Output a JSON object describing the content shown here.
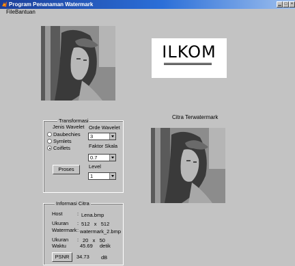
{
  "window": {
    "title": "Program Penanaman Watermark"
  },
  "menu": {
    "items": [
      "File",
      "Bantuan"
    ]
  },
  "logo": {
    "text": "ILKOM"
  },
  "watermarked": {
    "title": "Citra Terwatermark"
  },
  "transform": {
    "title": "Transformasi",
    "wavelet_type_label": "Jenis Wavelet",
    "options": [
      "Daubechies",
      "Symlets",
      "Coiflets"
    ],
    "selected_index": 2,
    "order_label": "Orde Wavelet",
    "order_value": "3",
    "scale_label": "Faktor Skala",
    "scale_value": "0.7",
    "level_label": "Level",
    "level_value": "1",
    "process_button": "Proses"
  },
  "info": {
    "title": "Informasi Citra",
    "host_label": "Host",
    "host_colon": ":",
    "host_value": "Lena.bmp",
    "size1_label": "Ukuran",
    "size1_colon": ":",
    "size1_value": "512   x   512",
    "watermark_label": "Watermark",
    "watermark_colon": ":",
    "watermark_value": "watermark_2.bmp",
    "size2_label": "Ukuran",
    "size2_colon": ":",
    "size2_value": "20   x   50",
    "time_label": "Waktu",
    "time_value": "45.69",
    "time_unit": "detik",
    "psnr_button": "PSNR",
    "psnr_value": "34.73",
    "psnr_unit": "dB"
  }
}
